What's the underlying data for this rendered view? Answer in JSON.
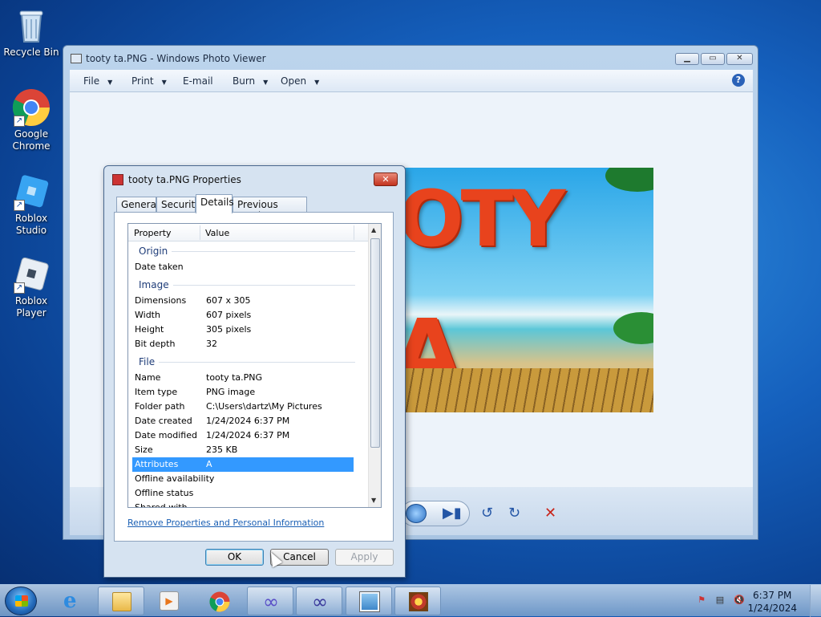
{
  "desktop": {
    "icons": [
      {
        "label": "Recycle Bin",
        "icon": "recycle-bin-icon"
      },
      {
        "label": "Google Chrome",
        "icon": "chrome-icon"
      },
      {
        "label": "Roblox Studio",
        "icon": "roblox-studio-icon"
      },
      {
        "label": "Roblox Player",
        "icon": "roblox-player-icon"
      }
    ]
  },
  "photo_viewer": {
    "title": "tooty ta.PNG - Windows Photo Viewer",
    "menu": [
      {
        "label": "File",
        "arrow": "▼"
      },
      {
        "label": "Print",
        "arrow": "▼"
      },
      {
        "label": "E-mail",
        "arrow": ""
      },
      {
        "label": "Burn",
        "arrow": "▼"
      },
      {
        "label": "Open",
        "arrow": "▼"
      }
    ],
    "help": "?",
    "image_text_line1": "OTY",
    "image_text_line2": "A"
  },
  "dialog": {
    "title": "tooty ta.PNG Properties",
    "close_glyph": "✕",
    "tabs": [
      "General",
      "Security",
      "Details",
      "Previous Versions"
    ],
    "active_tab": "Details",
    "columns": {
      "property": "Property",
      "value": "Value"
    },
    "groups": {
      "origin": "Origin",
      "image": "Image",
      "file": "File"
    },
    "origin_rows": [
      {
        "k": "Date taken",
        "v": ""
      }
    ],
    "image_rows": [
      {
        "k": "Dimensions",
        "v": "607 x 305"
      },
      {
        "k": "Width",
        "v": "607 pixels"
      },
      {
        "k": "Height",
        "v": "305 pixels"
      },
      {
        "k": "Bit depth",
        "v": "32"
      }
    ],
    "file_rows": [
      {
        "k": "Name",
        "v": "tooty ta.PNG"
      },
      {
        "k": "Item type",
        "v": "PNG image"
      },
      {
        "k": "Folder path",
        "v": "C:\\Users\\dartz\\My Pictures"
      },
      {
        "k": "Date created",
        "v": "1/24/2024 6:37 PM"
      },
      {
        "k": "Date modified",
        "v": "1/24/2024 6:37 PM"
      },
      {
        "k": "Size",
        "v": "235 KB"
      },
      {
        "k": "Attributes",
        "v": "A"
      },
      {
        "k": "Offline availability",
        "v": ""
      },
      {
        "k": "Offline status",
        "v": ""
      },
      {
        "k": "Shared with",
        "v": ""
      }
    ],
    "link": "Remove Properties and Personal Information",
    "buttons": {
      "ok": "OK",
      "cancel": "Cancel",
      "apply": "Apply"
    }
  },
  "taskbar": {
    "time": "6:37 PM",
    "date": "1/24/2024"
  },
  "colors": {
    "selection": "#3399ff",
    "accent_link": "#1a5fb4",
    "close_red": "#c3331e"
  }
}
